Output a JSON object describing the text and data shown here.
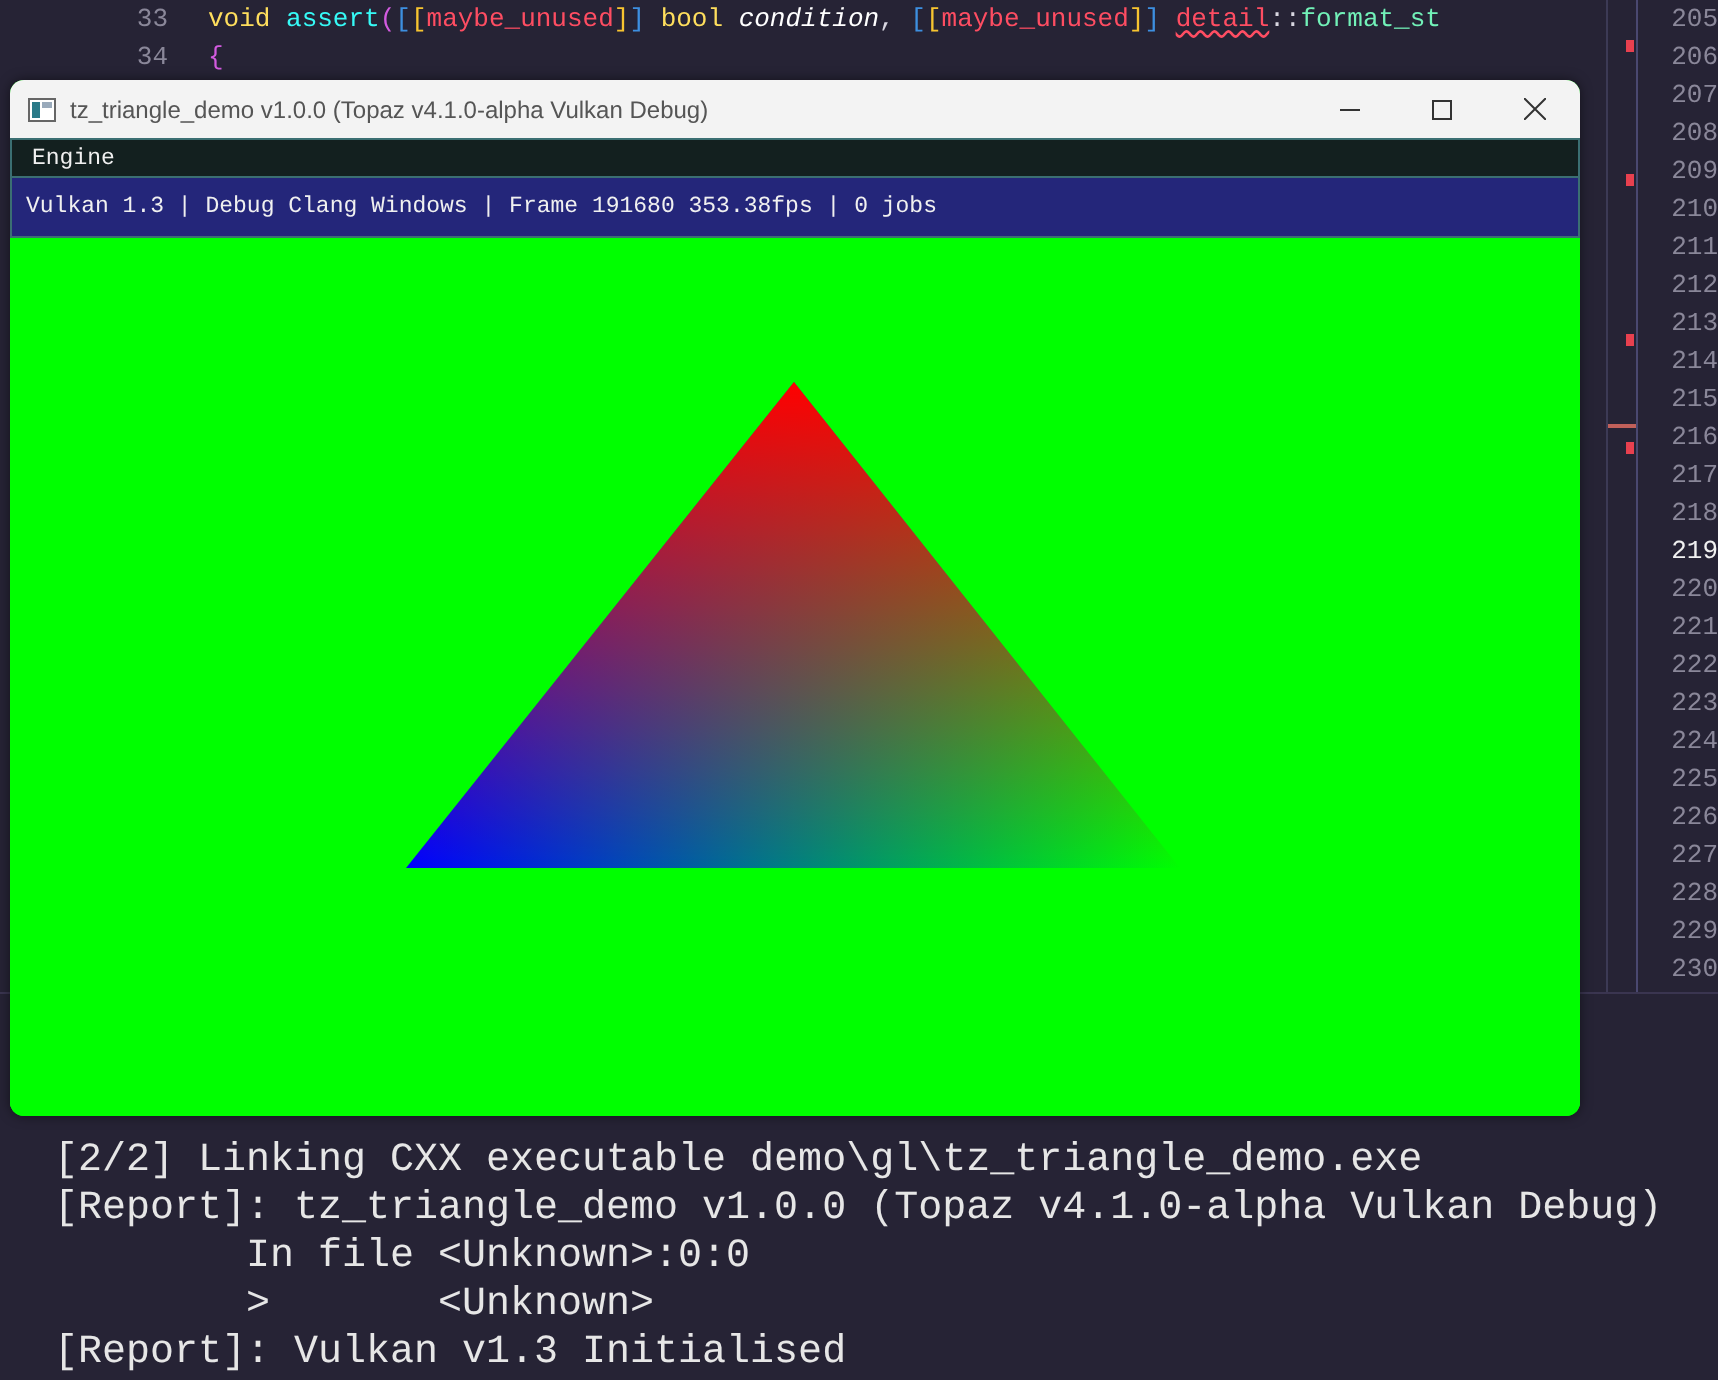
{
  "editor": {
    "lines": [
      {
        "number": "33",
        "tokens": [
          {
            "text": "void",
            "kind": "keyword"
          },
          {
            "text": " assert",
            "kind": "function"
          },
          {
            "text": "(",
            "kind": "paren"
          },
          {
            "text": "[",
            "kind": "square"
          },
          {
            "text": "[",
            "kind": "square2"
          },
          {
            "text": "maybe_unused",
            "kind": "attribute"
          },
          {
            "text": "]",
            "kind": "square2"
          },
          {
            "text": "]",
            "kind": "square"
          },
          {
            "text": " bool",
            "kind": "keyword"
          },
          {
            "text": " condition",
            "kind": "param"
          },
          {
            "text": ", ",
            "kind": "plain"
          },
          {
            "text": "[",
            "kind": "square"
          },
          {
            "text": "[",
            "kind": "square2"
          },
          {
            "text": "maybe_unused",
            "kind": "attribute"
          },
          {
            "text": "]",
            "kind": "square2"
          },
          {
            "text": "] ",
            "kind": "square"
          },
          {
            "text": "detail",
            "kind": "error"
          },
          {
            "text": "::",
            "kind": "plain"
          },
          {
            "text": "format_st",
            "kind": "name"
          }
        ]
      },
      {
        "number": "34",
        "tokens": [
          {
            "text": "{",
            "kind": "paren"
          }
        ]
      }
    ]
  },
  "side_numbers": [
    {
      "number": "205",
      "selected": false
    },
    {
      "number": "206",
      "selected": false
    },
    {
      "number": "207",
      "selected": false
    },
    {
      "number": "208",
      "selected": false
    },
    {
      "number": "209",
      "selected": false
    },
    {
      "number": "210",
      "selected": false
    },
    {
      "number": "211",
      "selected": false
    },
    {
      "number": "212",
      "selected": false
    },
    {
      "number": "213",
      "selected": false
    },
    {
      "number": "214",
      "selected": false
    },
    {
      "number": "215",
      "selected": false
    },
    {
      "number": "216",
      "selected": false
    },
    {
      "number": "217",
      "selected": false
    },
    {
      "number": "218",
      "selected": false
    },
    {
      "number": "219",
      "selected": true
    },
    {
      "number": "220",
      "selected": false
    },
    {
      "number": "221",
      "selected": false
    },
    {
      "number": "222",
      "selected": false
    },
    {
      "number": "223",
      "selected": false
    },
    {
      "number": "224",
      "selected": false
    },
    {
      "number": "225",
      "selected": false
    },
    {
      "number": "226",
      "selected": false
    },
    {
      "number": "227",
      "selected": false
    },
    {
      "number": "228",
      "selected": false
    },
    {
      "number": "229",
      "selected": false
    },
    {
      "number": "230",
      "selected": false
    }
  ],
  "terminal": {
    "lines": [
      "[2/2] Linking CXX executable demo\\gl\\tz_triangle_demo.exe",
      "[Report]: tz_triangle_demo v1.0.0 (Topaz v4.1.0-alpha Vulkan Debug)",
      "        In file <Unknown>:0:0",
      "        >       <Unknown>",
      "[Report]: Vulkan v1.3 Initialised"
    ]
  },
  "window": {
    "title": "tz_triangle_demo v1.0.0 (Topaz v4.1.0-alpha Vulkan Debug)",
    "menu": [
      "Engine"
    ],
    "status": "Vulkan 1.3 | Debug Clang Windows | Frame 191680 353.38fps | 0 jobs"
  }
}
